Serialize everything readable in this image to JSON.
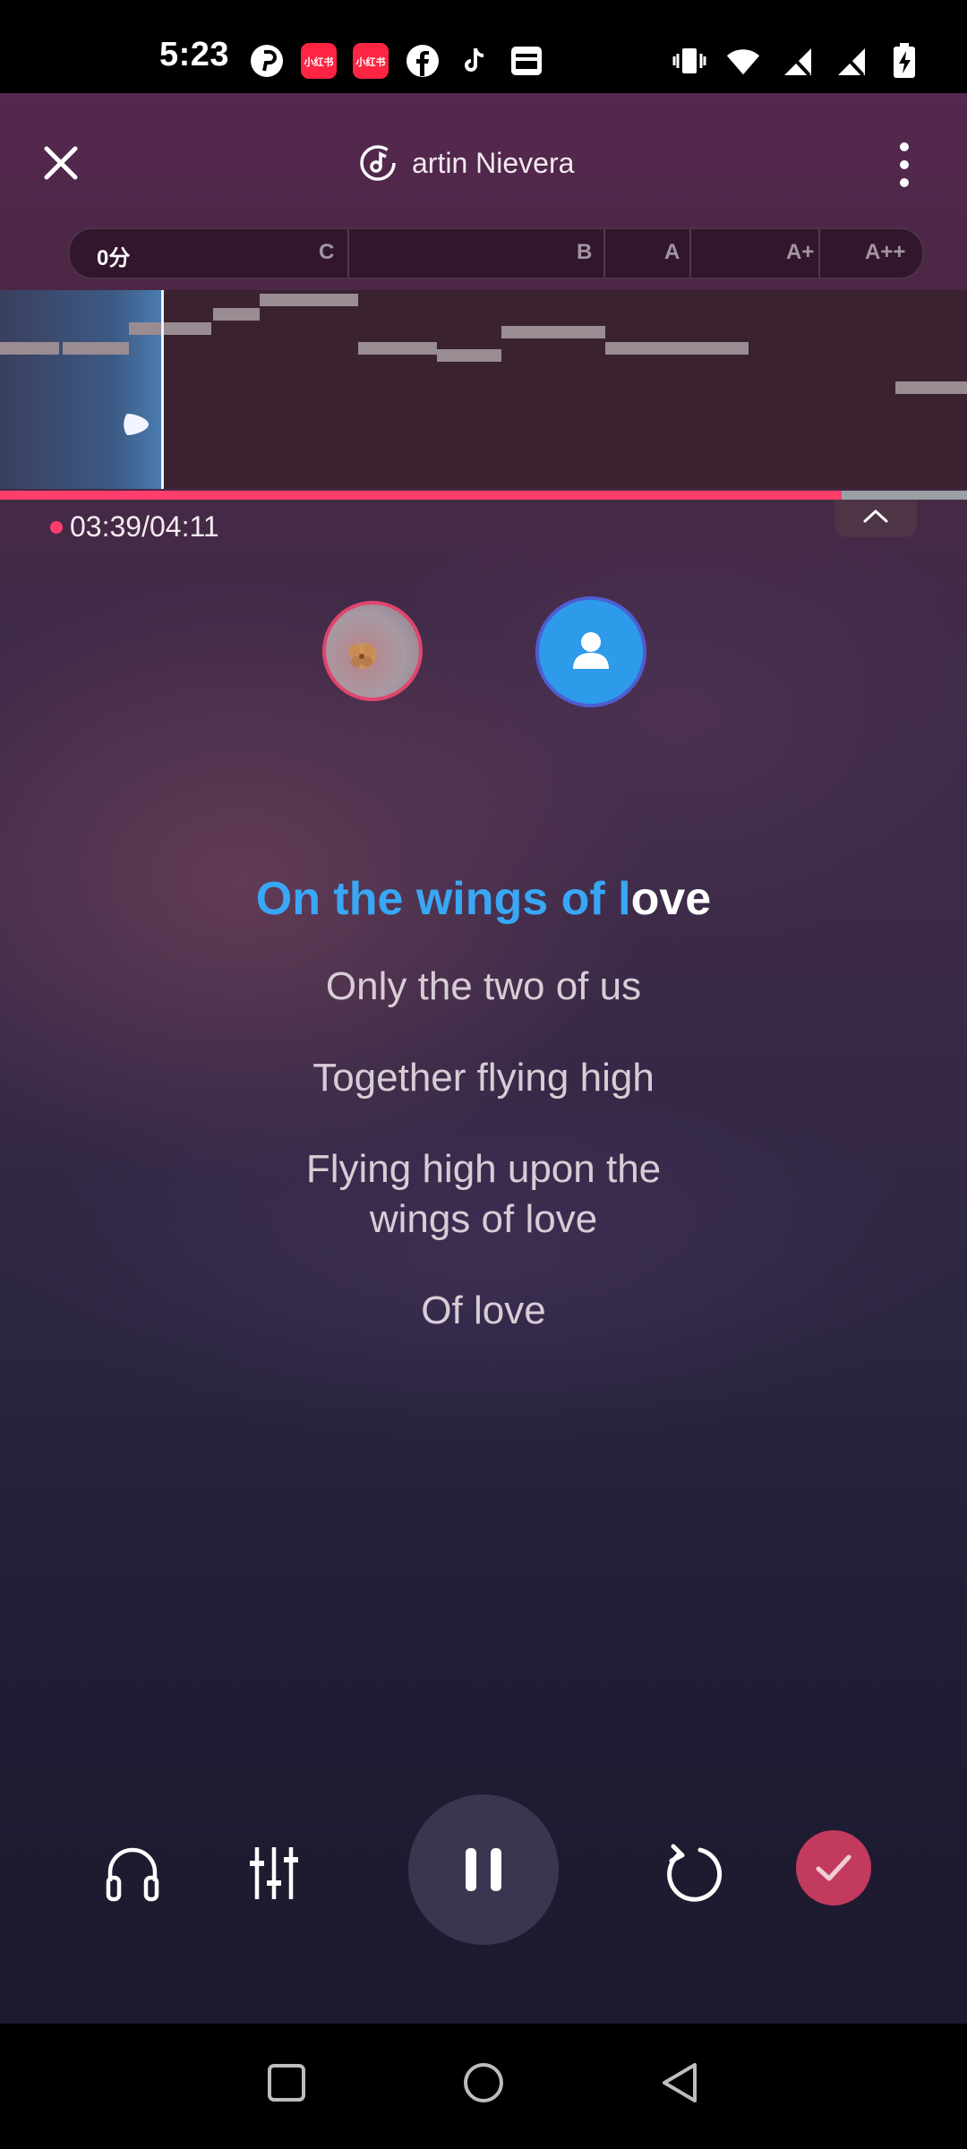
{
  "status_bar": {
    "time": "5:23",
    "left_icons": [
      "pinterest-icon",
      "xiaohongshu-icon",
      "xiaohongshu-icon",
      "facebook-icon",
      "tiktok-icon",
      "inbox-icon"
    ],
    "xiaohongshu_label": "小红书",
    "right_icons": [
      "vibrate-icon",
      "wifi-icon",
      "no-signal-icon",
      "no-signal-icon",
      "battery-charging-icon"
    ]
  },
  "header": {
    "song_title": "artin Nievera",
    "close_icon": "close-icon",
    "more_icon": "more-vertical-icon",
    "music_icon": "music-note-icon"
  },
  "score_bar": {
    "score": "0分",
    "grades": [
      "C",
      "B",
      "A",
      "A+",
      "A++"
    ]
  },
  "playback": {
    "time": "03:39/04:11",
    "progress": 0.87
  },
  "singers": [
    {
      "name": "avatar-photo"
    },
    {
      "name": "avatar-default-user"
    }
  ],
  "lyrics": {
    "current_sung": "On the wings of l",
    "current_unsung": "ove",
    "upcoming": [
      "Only the two of us",
      "Together flying high",
      "Flying high upon the wings of love",
      "Of love"
    ]
  },
  "controls": {
    "icons": [
      "headphones-icon",
      "equalizer-icon",
      "pause-icon",
      "restart-icon",
      "check-icon"
    ]
  },
  "colors": {
    "accent_pink": "#ff3e6c",
    "lyric_highlight": "#38a7f5",
    "done_button": "#c23a5e"
  }
}
